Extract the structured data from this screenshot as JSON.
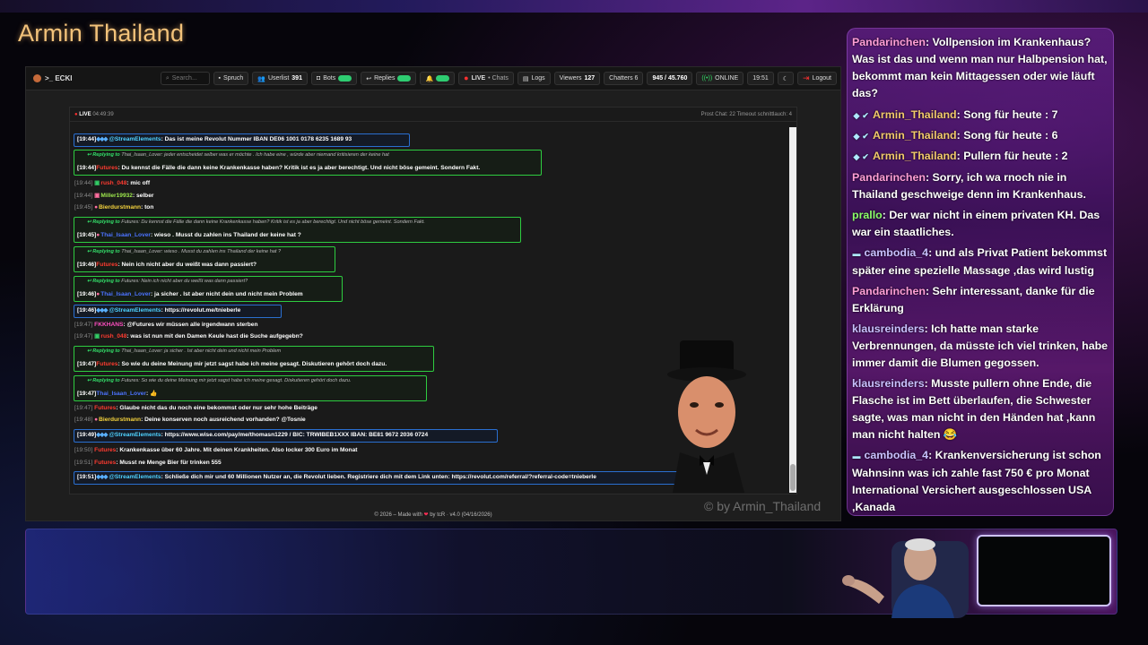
{
  "overlay": {
    "stream_title": "Armin Thailand",
    "watermark": "© by Armin_Thailand"
  },
  "topbar": {
    "brand": ">_ ECKI",
    "search_placeholder": "Search...",
    "spruch": "Spruch",
    "userlist_label": "Userlist",
    "userlist_count": "391",
    "bots": "Bots",
    "replies": "Replies",
    "live": "LIVE",
    "chats": "• Chats",
    "logs": "Logs",
    "viewers_label": "Viewers",
    "viewers_count": "127",
    "chatters": "Chatters 6",
    "ratio": "945 / 45.760",
    "online": "ONLINE",
    "clock": "19:51",
    "logout": "Logout"
  },
  "chat_header": {
    "live": "LIVE",
    "uptime": "04:49:39",
    "right": "Prost Chat: 22  Timeout schnittlauch: 4"
  },
  "messages": {
    "m1": {
      "ts": "[19:44]",
      "user": "@StreamElements",
      "text": ": Das ist meine Revolut Nummer IBAN DE06 1001 0178 6235 1689 93"
    },
    "m2": {
      "reply_label": "Replying to",
      "reply_text": "Thai_Isaan_Lover: jeder entscheidet selber was er möchte . Ich habe eine , würde aber niemand kritisieren der keine hat",
      "ts": "[19:44]",
      "user": "Futures",
      "text": ": Du kennst die Fälle die dann keine Krankenkasse haben? Kritik ist es ja aber berechtigt. Und nicht böse gemeint. Sondern Fakt."
    },
    "m3": {
      "ts": "[19:44]",
      "user": "rush_048",
      "text": ": mic off"
    },
    "m4": {
      "ts": "[19:44]",
      "user": "Miller19932",
      "text": ": selber"
    },
    "m5": {
      "ts": "[19:45]",
      "user": "Bierdurstmann",
      "text": ": ton"
    },
    "m6": {
      "reply_label": "Replying to",
      "reply_text": "Futures: Du kennst die Fälle die dann keine Krankenkasse haben? Kritik ist es ja aber berechtigt. Und nicht böse gemeint. Sondern Fakt.",
      "ts": "[19:45]",
      "user": "Thai_Isaan_Lover",
      "text": ": wieso . Musst du zahlen ins Thailand der keine hat ?"
    },
    "m7": {
      "reply_label": "Replying to",
      "reply_text": "Thai_Isaan_Lover: wieso . Musst du zahlen ins Thailand der keine hat ?",
      "ts": "[19:46]",
      "user": "Futures",
      "text": ": Nein ich nicht aber du weißt was dann passiert?"
    },
    "m8": {
      "reply_label": "Replying to",
      "reply_text": "Futures: Nein ich nicht aber du weißt was dann passiert?",
      "ts": "[19:46]",
      "user": "Thai_Isaan_Lover",
      "text": ": ja sicher . Ist aber nicht dein und nicht mein Problem"
    },
    "m9": {
      "ts": "[19:46]",
      "user": "@StreamElements",
      "text": ": https://revolut.me/tnieberle"
    },
    "m10": {
      "ts": "[19:47]",
      "user": "FKKHANS",
      "text": ": @Futures wir müssen alle irgendwann sterben"
    },
    "m11": {
      "ts": "[19:47]",
      "user": "rush_048",
      "text": ": was ist nun mit den Damen Keule hast die Suche aufgegebn?"
    },
    "m12": {
      "reply_label": "Replying to",
      "reply_text": "Thai_Isaan_Lover: ja sicher . Ist aber nicht dein und nicht mein Problem",
      "ts": "[19:47]",
      "user": "Futures",
      "text": ": So wie du deine Meinung mir jetzt sagst habe ich meine gesagt. Diskutieren gehört doch dazu."
    },
    "m13": {
      "reply_label": "Replying to",
      "reply_text": "Futures: So wie du deine Meinung mir jetzt sagst habe ich meine gesagt. Diskutieren gehört doch dazu.",
      "ts": "[19:47]",
      "user": "Thai_Isaan_Lover",
      "text": ": 👍"
    },
    "m14": {
      "ts": "[19:47]",
      "user": "Futures",
      "text": ": Glaube nicht das du noch eine bekommst oder nur sehr hohe Beiträge"
    },
    "m15": {
      "ts": "[19:48]",
      "user": "Bierdurstmann",
      "text": ": Deine konserven noch ausreichend vorhanden? @Tosnie"
    },
    "m16": {
      "ts": "[19:49]",
      "user": "@StreamElements",
      "text": ": https://www.wise.com/pay/me/thomasn1229 / BIC: TRWIBEB1XXX IBAN: BE81 9672 2036 0724"
    },
    "m17": {
      "ts": "[19:50]",
      "user": "Futures",
      "text": ": Krankenkasse über 60 Jahre. Mit deinen Krankheiten. Also locker 300 Euro im Monat"
    },
    "m18": {
      "ts": "[19:51]",
      "user": "Futures",
      "text": ": Musst ne Menge Bier für trinken 555"
    },
    "m19": {
      "ts": "[19:51]",
      "user": "@StreamElements",
      "text": ": Schließe dich mir und 60 Millionen Nutzer an, die Revolut lieben. Registriere dich mit dem Link unten: https://revolut.com/referral/?referral-code=tnieberle"
    }
  },
  "footer": {
    "left": "© 2026 – Made with",
    "heart": "❤",
    "right": "by tcR · v4.0 (04/16/2026)"
  },
  "right_chat": [
    {
      "user": "Pandarinchen",
      "text": ": Vollpension im Krankenhaus? Was ist das und wenn man nur Halbpension hat, bekommt man kein Mittagessen oder wie läuft das?"
    },
    {
      "user": "Armin_Thailand",
      "text": ": Song für heute : 7"
    },
    {
      "user": "Armin_Thailand",
      "text": ": Song für heute : 6"
    },
    {
      "user": "Armin_Thailand",
      "text": ": Pullern für heute : 2"
    },
    {
      "user": "Pandarinchen",
      "text": ": Sorry, ich wa rnoch nie in Thailand geschweige denn im Krankenhaus."
    },
    {
      "user": "prallo",
      "text": ": Der war nicht in einem privaten KH. Das war ein staatliches."
    },
    {
      "user": "cambodia_4",
      "text": ": und als Privat Patient bekommst später eine spezielle Massage ,das wird lustig"
    },
    {
      "user": "Pandarinchen",
      "text": ": Sehr interessant, danke für die Erklärung"
    },
    {
      "user": "klausreinders",
      "text": ": Ich hatte man starke Verbrennungen, da müsste ich viel trinken, habe immer damit die Blumen gegossen."
    },
    {
      "user": "klausreinders",
      "text": ": Musste pullern ohne Ende, die Flasche ist im Bett überlaufen, die Schwester sagte, was man nicht in den Händen hat ,kann man nicht halten 😂"
    },
    {
      "user": "cambodia_4",
      "text": ": Krankenversicherung ist schon Wahnsinn was ich zahle fast 750 € pro Monat International Versichert ausgeschlossen USA ,Kanada"
    }
  ]
}
